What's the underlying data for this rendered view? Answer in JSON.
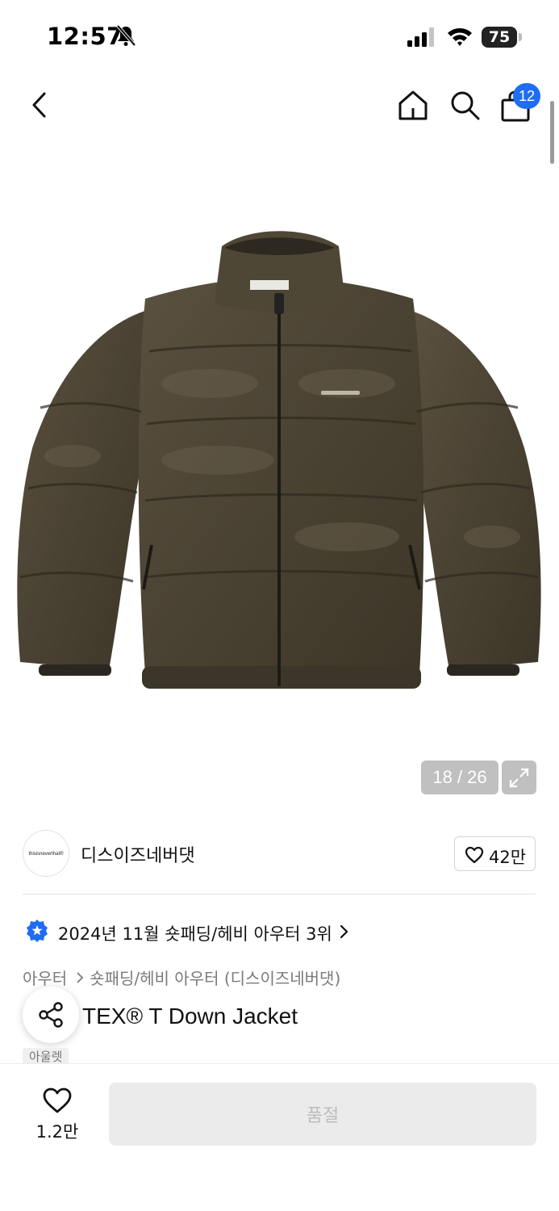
{
  "status_bar": {
    "time": "12:57",
    "battery": "75"
  },
  "nav": {
    "cart_count": "12"
  },
  "gallery": {
    "counter": "18 / 26"
  },
  "brand": {
    "logo_text": "thisisneverthat®",
    "name": "디스이즈네버댓",
    "like_count": "42만"
  },
  "ranking": {
    "text": "2024년 11월 숏패딩/헤비 아우터 3위"
  },
  "breadcrumb": {
    "items": [
      "아우터",
      "숏패딩/헤비 아우터 (디스이즈네버댓)"
    ]
  },
  "product": {
    "title_visible": "TEX® T Down Jacket",
    "tag": "아울렛"
  },
  "bottom": {
    "wish_count": "1.2만",
    "button_label": "품절"
  },
  "colors": {
    "accent": "#1f6cf5",
    "jacket": "#4a4232"
  }
}
